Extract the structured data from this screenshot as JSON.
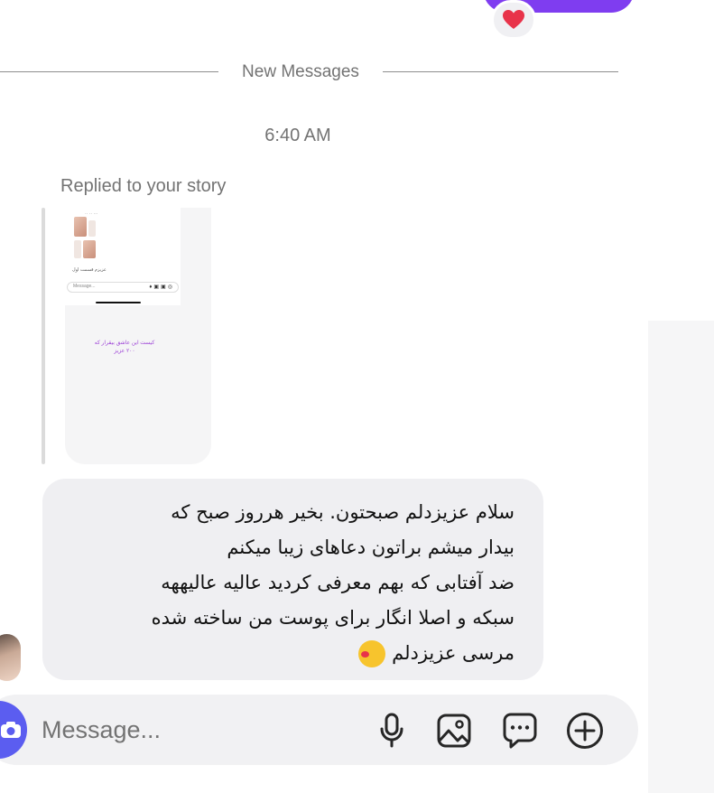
{
  "thread": {
    "top_reaction": "❤️",
    "new_messages_divider": "New Messages",
    "timestamp": "6:40 AM",
    "replied_label": "Replied to your story",
    "story_preview": {
      "placeholder": "Message...",
      "caption_line1": "عزیزم قسمت اول",
      "text_line1": "کیست این عاشق بیقرار که",
      "text_line2": "۲۰۰ عزیز"
    },
    "incoming_message": "سلام عزیزدلم صبحتون. بخیر هرروز صبح که\nبیدار میشم براتون دعاهای زیبا میکنم\nضد آفتابی که بهم معرفی کردید عالیه عالیههه\nسبکه و اصلا انگار برای پوست من ساخته شده\nمرسی عزیزدلم"
  },
  "composer": {
    "placeholder": "Message...",
    "icons": [
      "camera-icon",
      "microphone-icon",
      "image-icon",
      "sticker-icon",
      "plus-icon"
    ]
  },
  "colors": {
    "accent_purple": "#7f3df0",
    "camera_blue": "#5b5df0",
    "bubble_gray": "#efeff2",
    "heart_red": "#e8334a"
  }
}
